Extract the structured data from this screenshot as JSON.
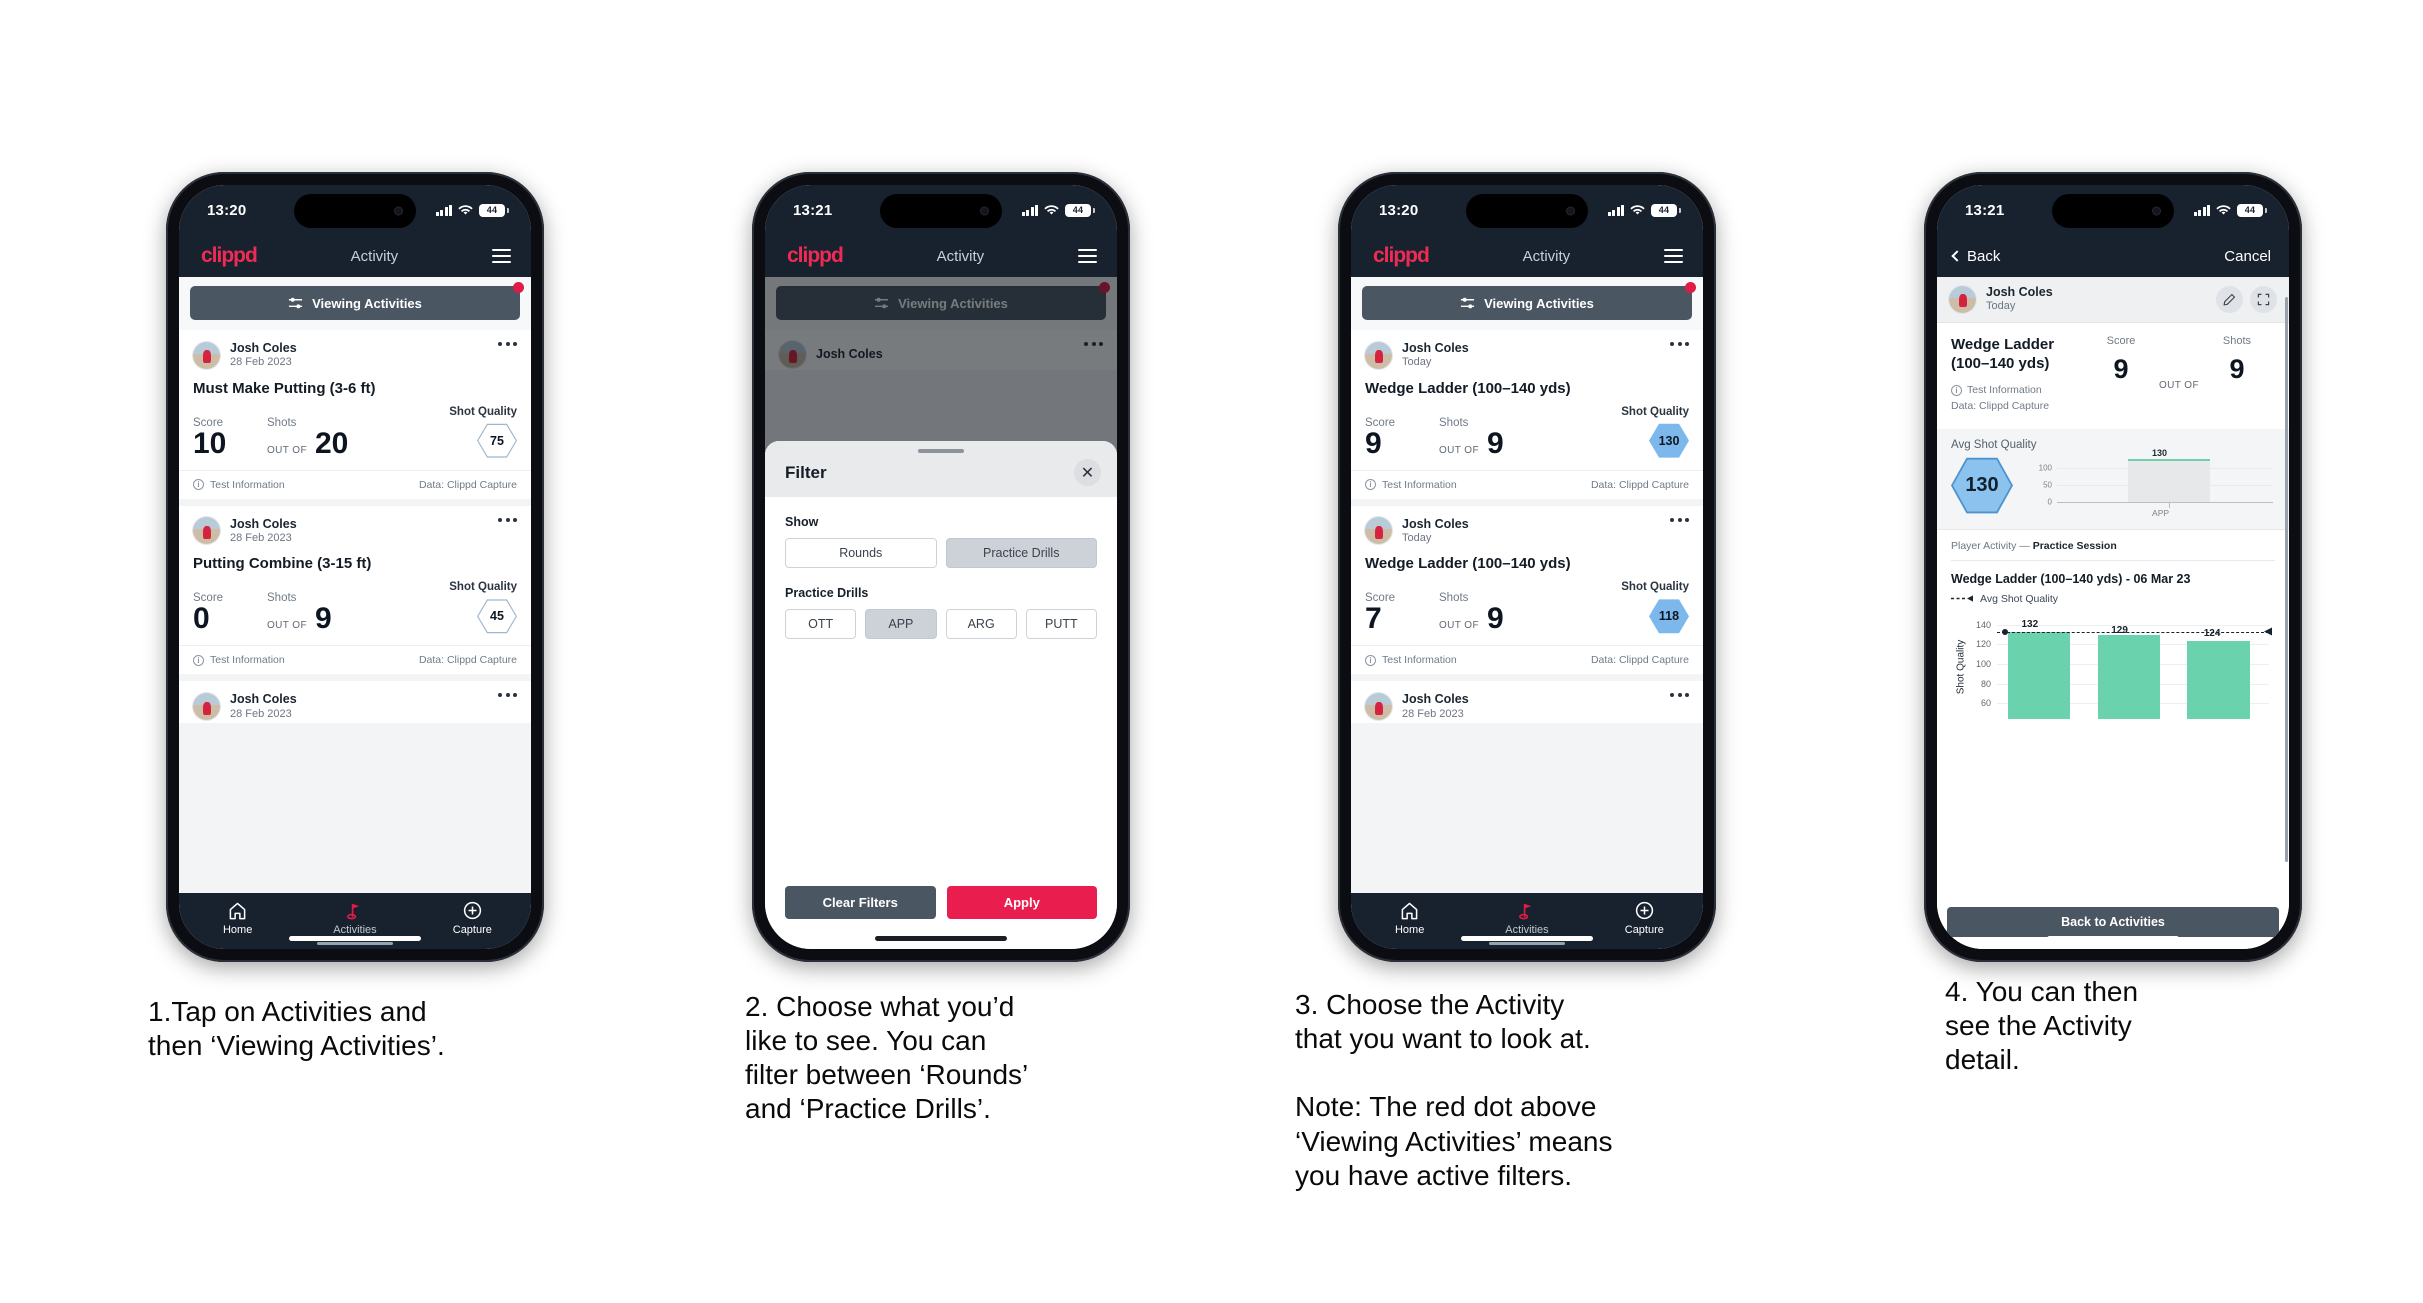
{
  "brand": {
    "logo": "clippd",
    "accent": "#e01b45",
    "dark": "#18222e",
    "slate": "#4b5663"
  },
  "phones": [
    {
      "status": {
        "time": "13:20",
        "battery": "44"
      },
      "header": {
        "logo": "clippd",
        "title": "Activity",
        "menu_icon": "hamburger-icon"
      },
      "filter_bar": {
        "label": "Viewing Activities",
        "icon": "sliders-icon",
        "has_badge": true
      },
      "cards": [
        {
          "user": "Josh Coles",
          "date": "28 Feb 2023",
          "title": "Must Make Putting (3-6 ft)",
          "score_label": "Score",
          "shots_label": "Shots",
          "quality_label": "Shot Quality",
          "score": "10",
          "out_of": "OUT OF",
          "shots": "20",
          "quality": "75",
          "quality_style": "outline",
          "foot_left": "Test Information",
          "foot_right": "Data: Clippd Capture"
        },
        {
          "user": "Josh Coles",
          "date": "28 Feb 2023",
          "title": "Putting Combine (3-15 ft)",
          "score_label": "Score",
          "shots_label": "Shots",
          "quality_label": "Shot Quality",
          "score": "0",
          "out_of": "OUT OF",
          "shots": "9",
          "quality": "45",
          "quality_style": "outline",
          "foot_left": "Test Information",
          "foot_right": "Data: Clippd Capture"
        },
        {
          "user": "Josh Coles",
          "date": "28 Feb 2023",
          "partial": true
        }
      ],
      "tabs": [
        {
          "label": "Home",
          "icon": "home-icon",
          "active": false
        },
        {
          "label": "Activities",
          "icon": "golf-flag-icon",
          "active": true
        },
        {
          "label": "Capture",
          "icon": "plus-circle-icon",
          "active": false
        }
      ]
    },
    {
      "status": {
        "time": "13:21",
        "battery": "44"
      },
      "header": {
        "logo": "clippd",
        "title": "Activity",
        "menu_icon": "hamburger-icon"
      },
      "filter_bar": {
        "label": "Viewing Activities",
        "icon": "sliders-icon",
        "has_badge": true
      },
      "cards": [
        {
          "user": "Josh Coles",
          "partial": true
        }
      ],
      "sheet": {
        "title": "Filter",
        "close_icon": "close-icon",
        "show_label": "Show",
        "show_options": [
          {
            "label": "Rounds",
            "selected": false
          },
          {
            "label": "Practice Drills",
            "selected": true
          }
        ],
        "drills_label": "Practice Drills",
        "drill_options": [
          {
            "label": "OTT",
            "selected": false
          },
          {
            "label": "APP",
            "selected": true
          },
          {
            "label": "ARG",
            "selected": false
          },
          {
            "label": "PUTT",
            "selected": false
          }
        ],
        "clear_label": "Clear Filters",
        "apply_label": "Apply"
      }
    },
    {
      "status": {
        "time": "13:20",
        "battery": "44"
      },
      "header": {
        "logo": "clippd",
        "title": "Activity",
        "menu_icon": "hamburger-icon"
      },
      "filter_bar": {
        "label": "Viewing Activities",
        "icon": "sliders-icon",
        "has_badge": true
      },
      "cards": [
        {
          "user": "Josh Coles",
          "date": "Today",
          "title": "Wedge Ladder (100–140 yds)",
          "score_label": "Score",
          "shots_label": "Shots",
          "quality_label": "Shot Quality",
          "score": "9",
          "out_of": "OUT OF",
          "shots": "9",
          "quality": "130",
          "quality_style": "fill",
          "foot_left": "Test Information",
          "foot_right": "Data: Clippd Capture"
        },
        {
          "user": "Josh Coles",
          "date": "Today",
          "title": "Wedge Ladder (100–140 yds)",
          "score_label": "Score",
          "shots_label": "Shots",
          "quality_label": "Shot Quality",
          "score": "7",
          "out_of": "OUT OF",
          "shots": "9",
          "quality": "118",
          "quality_style": "fill",
          "foot_left": "Test Information",
          "foot_right": "Data: Clippd Capture"
        },
        {
          "user": "Josh Coles",
          "date": "28 Feb 2023",
          "partial": true
        }
      ],
      "tabs": [
        {
          "label": "Home",
          "icon": "home-icon",
          "active": false
        },
        {
          "label": "Activities",
          "icon": "golf-flag-icon",
          "active": true
        },
        {
          "label": "Capture",
          "icon": "plus-circle-icon",
          "active": false
        }
      ]
    },
    {
      "status": {
        "time": "13:21",
        "battery": "44"
      },
      "nav": {
        "back_label": "Back",
        "cancel_label": "Cancel",
        "back_icon": "chevron-left-icon"
      },
      "user": {
        "name": "Josh Coles",
        "date": "Today"
      },
      "actions": [
        {
          "icon": "pencil-icon",
          "name": "edit-button"
        },
        {
          "icon": "expand-icon",
          "name": "fullscreen-button"
        }
      ],
      "detail": {
        "title": "Wedge Ladder\n(100–140 yds)",
        "info_label": "Test Information",
        "data_label": "Data: Clippd Capture",
        "score_label": "Score",
        "shots_label": "Shots",
        "score": "9",
        "out_of": "OUT OF",
        "shots": "9",
        "avg_label": "Avg Shot Quality",
        "avg_value": "130",
        "player_activity_prefix": "Player Activity — ",
        "player_activity_value": "Practice Session",
        "chart_title": "Wedge Ladder (100–140 yds) - 06 Mar 23",
        "legend_label": "Avg Shot Quality",
        "back_button": "Back to Activities"
      }
    }
  ],
  "chart_data": [
    {
      "type": "bar",
      "title": "Avg Shot Quality",
      "categories": [
        "APP"
      ],
      "values": [
        130
      ],
      "data_labels": [
        "130"
      ],
      "ylabel": "",
      "xlabel": "",
      "yticks": [
        0,
        50,
        100
      ],
      "ylim": [
        0,
        145
      ],
      "grid": true,
      "legend": false,
      "bar_color": "#e6e8ea",
      "cap_color": "#72cfae"
    },
    {
      "type": "bar",
      "title": "Wedge Ladder (100–140 yds) - 06 Mar 23",
      "categories": [
        "",
        "",
        ""
      ],
      "values": [
        132,
        129,
        124
      ],
      "data_labels": [
        "132",
        "129",
        "124"
      ],
      "ylabel": "Shot Quality",
      "xlabel": "",
      "yticks": [
        60,
        80,
        100,
        120,
        140
      ],
      "ylim": [
        50,
        148
      ],
      "grid": true,
      "legend": true,
      "legend_entries": [
        "Avg Shot Quality"
      ],
      "legend_position": "top-left",
      "bar_color": "#6ad3ae",
      "reference_line": {
        "label": "Avg Shot Quality",
        "style": "dashed",
        "value": 132
      }
    }
  ],
  "captions": [
    "1.Tap on Activities and\nthen ‘Viewing Activities’.",
    "2. Choose what you’d\nlike to see. You can\nfilter between ‘Rounds’\nand ‘Practice Drills’.",
    "3. Choose the Activity\nthat you want to look at.\n\nNote: The red dot above\n‘Viewing Activities’ means\nyou have active filters.",
    "4. You can then\nsee the Activity\ndetail."
  ]
}
